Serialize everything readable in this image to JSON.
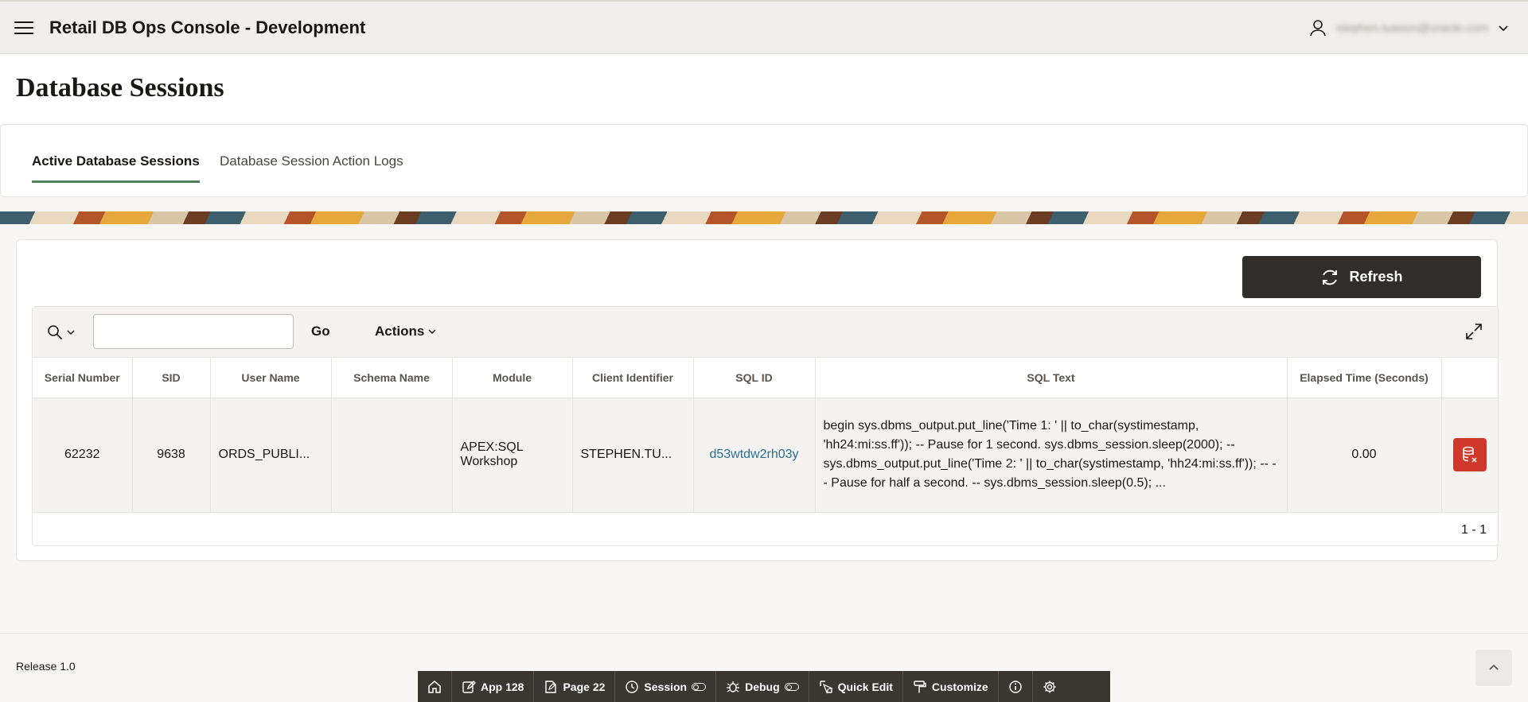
{
  "header": {
    "app_title": "Retail DB Ops Console - Development",
    "user_name": "stephen.tuason@oracle.com"
  },
  "page": {
    "title": "Database Sessions"
  },
  "tabs": [
    {
      "label": "Active Database Sessions",
      "active": true
    },
    {
      "label": "Database Session Action Logs",
      "active": false
    }
  ],
  "region": {
    "refresh_label": "Refresh"
  },
  "report": {
    "search_value": "",
    "go_label": "Go",
    "actions_label": "Actions",
    "columns": [
      "Serial Number",
      "SID",
      "User Name",
      "Schema Name",
      "Module",
      "Client Identifier",
      "SQL ID",
      "SQL Text",
      "Elapsed Time (Seconds)",
      ""
    ],
    "rows": [
      {
        "serial_number": "62232",
        "sid": "9638",
        "user_name": "ORDS_PUBLI...",
        "schema_name": "",
        "module": "APEX:SQL Workshop",
        "client_identifier": "STEPHEN.TU...",
        "sql_id": "d53wtdw2rh03y",
        "sql_text": "begin sys.dbms_output.put_line('Time 1: ' || to_char(systimestamp, 'hh24:mi:ss.ff')); -- Pause for 1 second. sys.dbms_session.sleep(2000); -- sys.dbms_output.put_line('Time 2: ' || to_char(systimestamp, 'hh24:mi:ss.ff')); -- -- Pause for half a second. -- sys.dbms_session.sleep(0.5); ...",
        "elapsed_time": "0.00"
      }
    ],
    "pagination": "1 - 1"
  },
  "footer": {
    "release": "Release 1.0"
  },
  "dev_toolbar": {
    "app": "App 128",
    "page": "Page 22",
    "session": "Session",
    "debug": "Debug",
    "quick_edit": "Quick Edit",
    "customize": "Customize"
  },
  "colors": {
    "header_bg": "#f1efed",
    "refresh_bg": "#312d2a",
    "kill_bg": "#d1382c",
    "tab_active_underline": "#4c825c",
    "link": "#2a6f92"
  }
}
